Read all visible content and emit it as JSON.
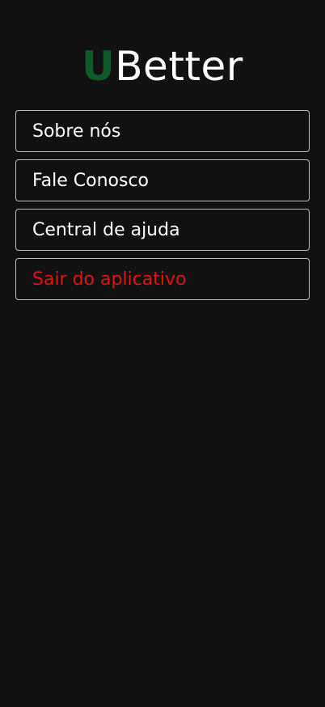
{
  "brand": {
    "logo_initial": "U",
    "logo_rest": "Better",
    "initial_color": "#0e5a2a"
  },
  "menu": {
    "items": [
      {
        "label": "Sobre nós"
      },
      {
        "label": "Fale Conosco"
      },
      {
        "label": "Central de ajuda"
      },
      {
        "label": "Sair do aplicativo",
        "color": "#e51212"
      }
    ]
  },
  "theme": {
    "background": "#111111",
    "border": "#bfbfbf",
    "text": "#ffffff"
  }
}
